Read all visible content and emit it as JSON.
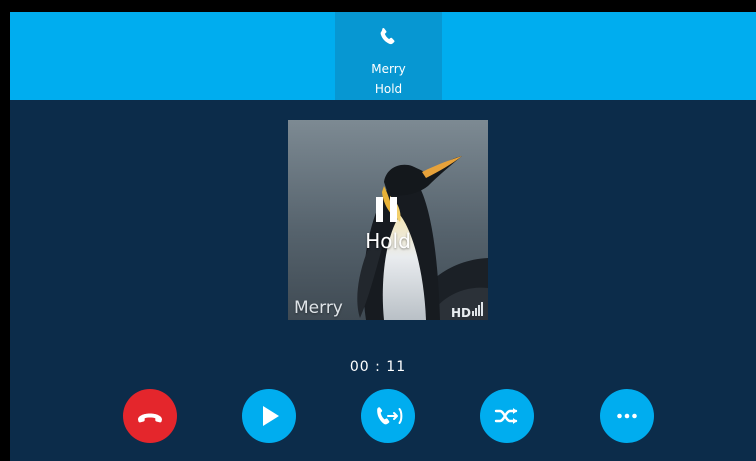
{
  "top_bar": {
    "call_tab": {
      "icon": "phone-handset-icon",
      "name": "Merry",
      "status": "Hold"
    }
  },
  "call_card": {
    "avatar_image": "penguin-photo",
    "state_icon": "pause-icon",
    "state_text": "Hold",
    "caller_name": "Merry",
    "quality_badge": "HD"
  },
  "timer": "00 : 11",
  "actions": [
    {
      "icon": "end-call-icon",
      "color": "#e4262c"
    },
    {
      "icon": "resume-play-icon",
      "color": "#00adef"
    },
    {
      "icon": "transfer-call-icon",
      "color": "#00adef"
    },
    {
      "icon": "swap-shuffle-icon",
      "color": "#00adef"
    },
    {
      "icon": "more-dots-icon",
      "color": "#00adef"
    }
  ],
  "colors": {
    "background": "#0c2c4a",
    "top_bar": "#00adef",
    "active_tab": "#0797d2",
    "end_call": "#e4262c"
  }
}
